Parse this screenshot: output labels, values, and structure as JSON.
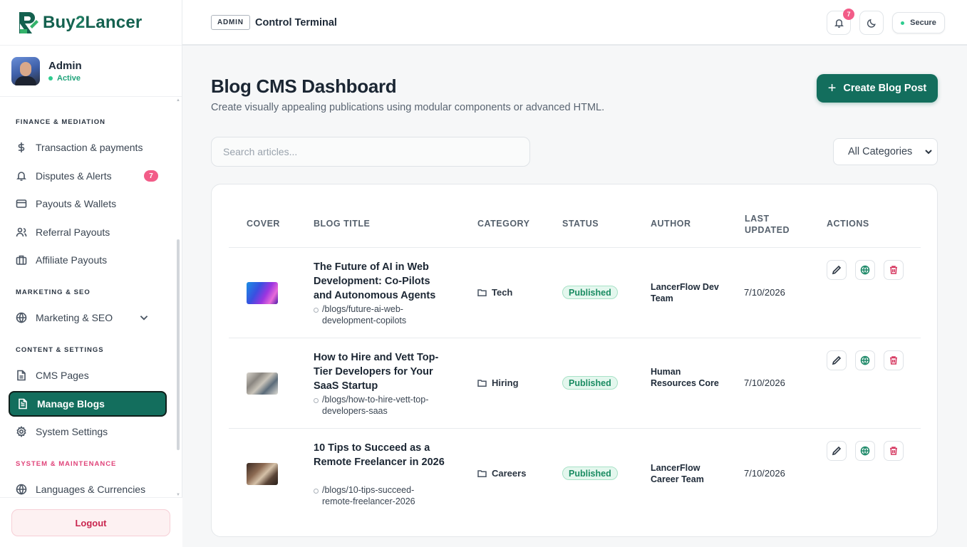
{
  "brand": {
    "name_part1": "Buy",
    "name_part2": "2",
    "name_part3": "Lancer"
  },
  "profile": {
    "name": "Admin",
    "status": "Active"
  },
  "sidebar": {
    "sections": [
      {
        "title": "FINANCE & MEDIATION"
      },
      {
        "title": "MARKETING & SEO"
      },
      {
        "title": "CONTENT & SETTINGS"
      },
      {
        "title": "SYSTEM & MAINTENANCE"
      }
    ],
    "items": [
      {
        "label": "Transaction & payments"
      },
      {
        "label": "Disputes & Alerts",
        "badge": "7"
      },
      {
        "label": "Payouts & Wallets"
      },
      {
        "label": "Referral Payouts"
      },
      {
        "label": "Affiliate Payouts"
      },
      {
        "label": "Marketing & SEO"
      },
      {
        "label": "CMS Pages"
      },
      {
        "label": "Manage Blogs"
      },
      {
        "label": "System Settings"
      },
      {
        "label": "Languages & Currencies"
      }
    ],
    "logout": "Logout"
  },
  "topbar": {
    "tag": "ADMIN",
    "title": "Control Terminal",
    "notifications": "7",
    "secure": "Secure"
  },
  "main": {
    "title": "Blog CMS Dashboard",
    "subtitle": "Create visually appealing publications using modular components or advanced HTML.",
    "create_label": "Create Blog Post",
    "search_placeholder": "Search articles...",
    "category_filter": "All Categories"
  },
  "table": {
    "headers": {
      "cover": "COVER",
      "title": "BLOG TITLE",
      "category": "CATEGORY",
      "status": "STATUS",
      "author": "AUTHOR",
      "updated_line1": "LAST",
      "updated_line2": "UPDATED",
      "actions": "ACTIONS"
    },
    "rows": [
      {
        "title": "The Future of AI in Web Development: Co-Pilots and Autonomous Agents",
        "slug": "/blogs/future-ai-web-development-copilots",
        "category": "Tech",
        "status": "Published",
        "author": "LancerFlow Dev Team",
        "updated": "7/10/2026"
      },
      {
        "title": "How to Hire and Vett Top-Tier Developers for Your SaaS Startup",
        "slug": "/blogs/how-to-hire-vett-top-developers-saas",
        "category": "Hiring",
        "status": "Published",
        "author": "Human Resources Core",
        "updated": "7/10/2026"
      },
      {
        "title": "10 Tips to Succeed as a Remote Freelancer in 2026",
        "slug": "/blogs/10-tips-succeed-remote-freelancer-2026",
        "category": "Careers",
        "status": "Published",
        "author": "LancerFlow Career Team",
        "updated": "7/10/2026"
      }
    ]
  },
  "colors": {
    "brand": "#136e5d",
    "accent_badge": "#f25c88",
    "status_green": "#1a8c62",
    "danger": "#d63a62"
  }
}
